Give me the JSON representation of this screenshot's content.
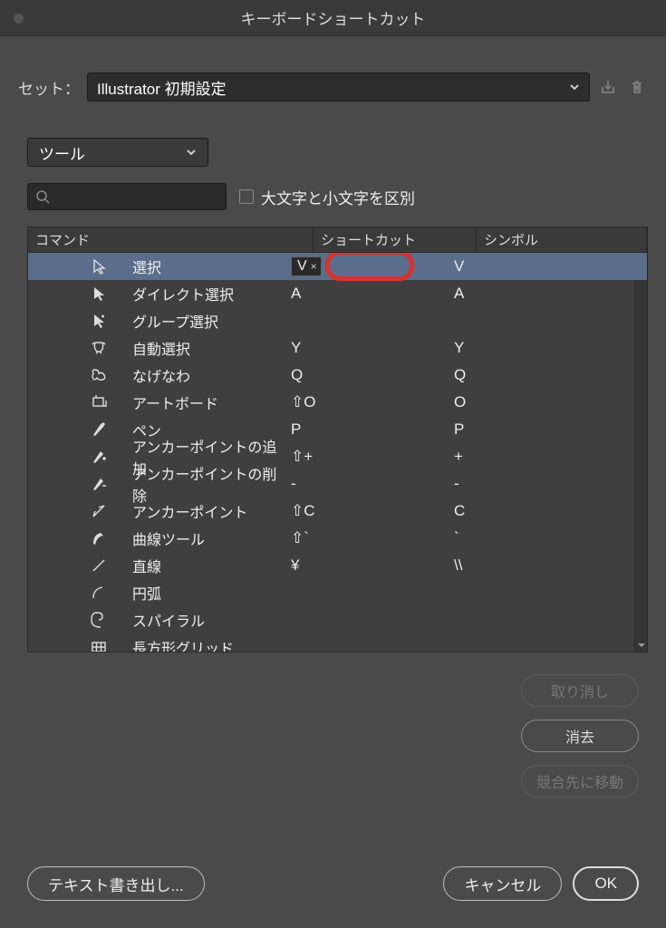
{
  "title": "キーボードショートカット",
  "set_label": "セット：",
  "set_value": "Illustrator 初期設定",
  "category": "ツール",
  "case_sensitive_label": "大文字と小文字を区別",
  "columns": {
    "command": "コマンド",
    "shortcut": "ショートカット",
    "symbol": "シンボル"
  },
  "rows": [
    {
      "cmd": "選択",
      "short": "V",
      "sym": "V",
      "selected": true,
      "editing": true
    },
    {
      "cmd": "ダイレクト選択",
      "short": "A",
      "sym": "A"
    },
    {
      "cmd": "グループ選択",
      "short": "",
      "sym": ""
    },
    {
      "cmd": "自動選択",
      "short": "Y",
      "sym": "Y"
    },
    {
      "cmd": "なげなわ",
      "short": "Q",
      "sym": "Q"
    },
    {
      "cmd": "アートボード",
      "short": "⇧O",
      "sym": "O"
    },
    {
      "cmd": "ペン",
      "short": "P",
      "sym": "P"
    },
    {
      "cmd": "アンカーポイントの追加",
      "short": "⇧+",
      "sym": "+"
    },
    {
      "cmd": "アンカーポイントの削除",
      "short": "-",
      "sym": "-"
    },
    {
      "cmd": "アンカーポイント",
      "short": "⇧C",
      "sym": "C"
    },
    {
      "cmd": "曲線ツール",
      "short": "⇧`",
      "sym": "`"
    },
    {
      "cmd": "直線",
      "short": "¥",
      "sym": "\\\\"
    },
    {
      "cmd": "円弧",
      "short": "",
      "sym": ""
    },
    {
      "cmd": "スパイラル",
      "short": "",
      "sym": ""
    },
    {
      "cmd": "長方形グリッド",
      "short": "",
      "sym": ""
    }
  ],
  "buttons": {
    "undo": "取り消し",
    "clear": "消去",
    "goto": "競合先に移動",
    "export": "テキスト書き出し...",
    "cancel": "キャンセル",
    "ok": "OK"
  }
}
